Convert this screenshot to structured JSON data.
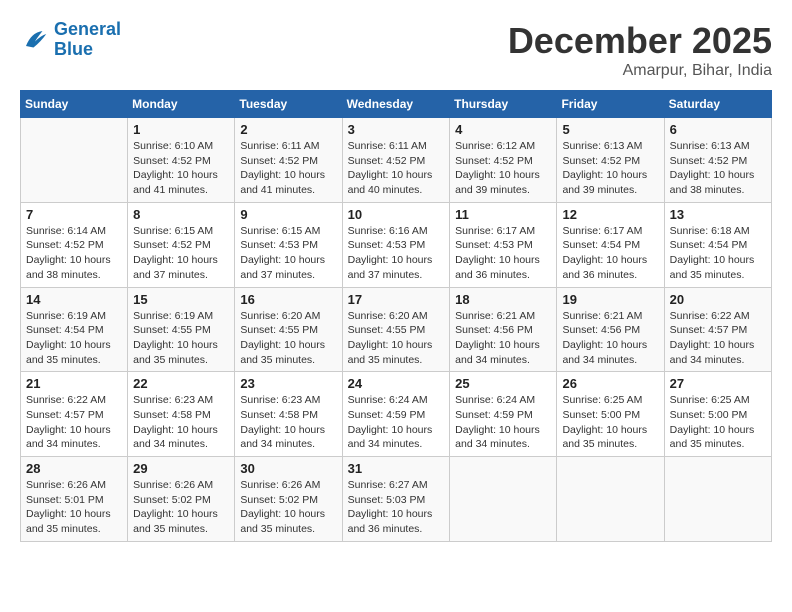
{
  "logo": {
    "line1": "General",
    "line2": "Blue"
  },
  "title": "December 2025",
  "subtitle": "Amarpur, Bihar, India",
  "days_of_week": [
    "Sunday",
    "Monday",
    "Tuesday",
    "Wednesday",
    "Thursday",
    "Friday",
    "Saturday"
  ],
  "weeks": [
    [
      {
        "num": "",
        "info": ""
      },
      {
        "num": "1",
        "info": "Sunrise: 6:10 AM\nSunset: 4:52 PM\nDaylight: 10 hours\nand 41 minutes."
      },
      {
        "num": "2",
        "info": "Sunrise: 6:11 AM\nSunset: 4:52 PM\nDaylight: 10 hours\nand 41 minutes."
      },
      {
        "num": "3",
        "info": "Sunrise: 6:11 AM\nSunset: 4:52 PM\nDaylight: 10 hours\nand 40 minutes."
      },
      {
        "num": "4",
        "info": "Sunrise: 6:12 AM\nSunset: 4:52 PM\nDaylight: 10 hours\nand 39 minutes."
      },
      {
        "num": "5",
        "info": "Sunrise: 6:13 AM\nSunset: 4:52 PM\nDaylight: 10 hours\nand 39 minutes."
      },
      {
        "num": "6",
        "info": "Sunrise: 6:13 AM\nSunset: 4:52 PM\nDaylight: 10 hours\nand 38 minutes."
      }
    ],
    [
      {
        "num": "7",
        "info": "Sunrise: 6:14 AM\nSunset: 4:52 PM\nDaylight: 10 hours\nand 38 minutes."
      },
      {
        "num": "8",
        "info": "Sunrise: 6:15 AM\nSunset: 4:52 PM\nDaylight: 10 hours\nand 37 minutes."
      },
      {
        "num": "9",
        "info": "Sunrise: 6:15 AM\nSunset: 4:53 PM\nDaylight: 10 hours\nand 37 minutes."
      },
      {
        "num": "10",
        "info": "Sunrise: 6:16 AM\nSunset: 4:53 PM\nDaylight: 10 hours\nand 37 minutes."
      },
      {
        "num": "11",
        "info": "Sunrise: 6:17 AM\nSunset: 4:53 PM\nDaylight: 10 hours\nand 36 minutes."
      },
      {
        "num": "12",
        "info": "Sunrise: 6:17 AM\nSunset: 4:54 PM\nDaylight: 10 hours\nand 36 minutes."
      },
      {
        "num": "13",
        "info": "Sunrise: 6:18 AM\nSunset: 4:54 PM\nDaylight: 10 hours\nand 35 minutes."
      }
    ],
    [
      {
        "num": "14",
        "info": "Sunrise: 6:19 AM\nSunset: 4:54 PM\nDaylight: 10 hours\nand 35 minutes."
      },
      {
        "num": "15",
        "info": "Sunrise: 6:19 AM\nSunset: 4:55 PM\nDaylight: 10 hours\nand 35 minutes."
      },
      {
        "num": "16",
        "info": "Sunrise: 6:20 AM\nSunset: 4:55 PM\nDaylight: 10 hours\nand 35 minutes."
      },
      {
        "num": "17",
        "info": "Sunrise: 6:20 AM\nSunset: 4:55 PM\nDaylight: 10 hours\nand 35 minutes."
      },
      {
        "num": "18",
        "info": "Sunrise: 6:21 AM\nSunset: 4:56 PM\nDaylight: 10 hours\nand 34 minutes."
      },
      {
        "num": "19",
        "info": "Sunrise: 6:21 AM\nSunset: 4:56 PM\nDaylight: 10 hours\nand 34 minutes."
      },
      {
        "num": "20",
        "info": "Sunrise: 6:22 AM\nSunset: 4:57 PM\nDaylight: 10 hours\nand 34 minutes."
      }
    ],
    [
      {
        "num": "21",
        "info": "Sunrise: 6:22 AM\nSunset: 4:57 PM\nDaylight: 10 hours\nand 34 minutes."
      },
      {
        "num": "22",
        "info": "Sunrise: 6:23 AM\nSunset: 4:58 PM\nDaylight: 10 hours\nand 34 minutes."
      },
      {
        "num": "23",
        "info": "Sunrise: 6:23 AM\nSunset: 4:58 PM\nDaylight: 10 hours\nand 34 minutes."
      },
      {
        "num": "24",
        "info": "Sunrise: 6:24 AM\nSunset: 4:59 PM\nDaylight: 10 hours\nand 34 minutes."
      },
      {
        "num": "25",
        "info": "Sunrise: 6:24 AM\nSunset: 4:59 PM\nDaylight: 10 hours\nand 34 minutes."
      },
      {
        "num": "26",
        "info": "Sunrise: 6:25 AM\nSunset: 5:00 PM\nDaylight: 10 hours\nand 35 minutes."
      },
      {
        "num": "27",
        "info": "Sunrise: 6:25 AM\nSunset: 5:00 PM\nDaylight: 10 hours\nand 35 minutes."
      }
    ],
    [
      {
        "num": "28",
        "info": "Sunrise: 6:26 AM\nSunset: 5:01 PM\nDaylight: 10 hours\nand 35 minutes."
      },
      {
        "num": "29",
        "info": "Sunrise: 6:26 AM\nSunset: 5:02 PM\nDaylight: 10 hours\nand 35 minutes."
      },
      {
        "num": "30",
        "info": "Sunrise: 6:26 AM\nSunset: 5:02 PM\nDaylight: 10 hours\nand 35 minutes."
      },
      {
        "num": "31",
        "info": "Sunrise: 6:27 AM\nSunset: 5:03 PM\nDaylight: 10 hours\nand 36 minutes."
      },
      {
        "num": "",
        "info": ""
      },
      {
        "num": "",
        "info": ""
      },
      {
        "num": "",
        "info": ""
      }
    ]
  ]
}
